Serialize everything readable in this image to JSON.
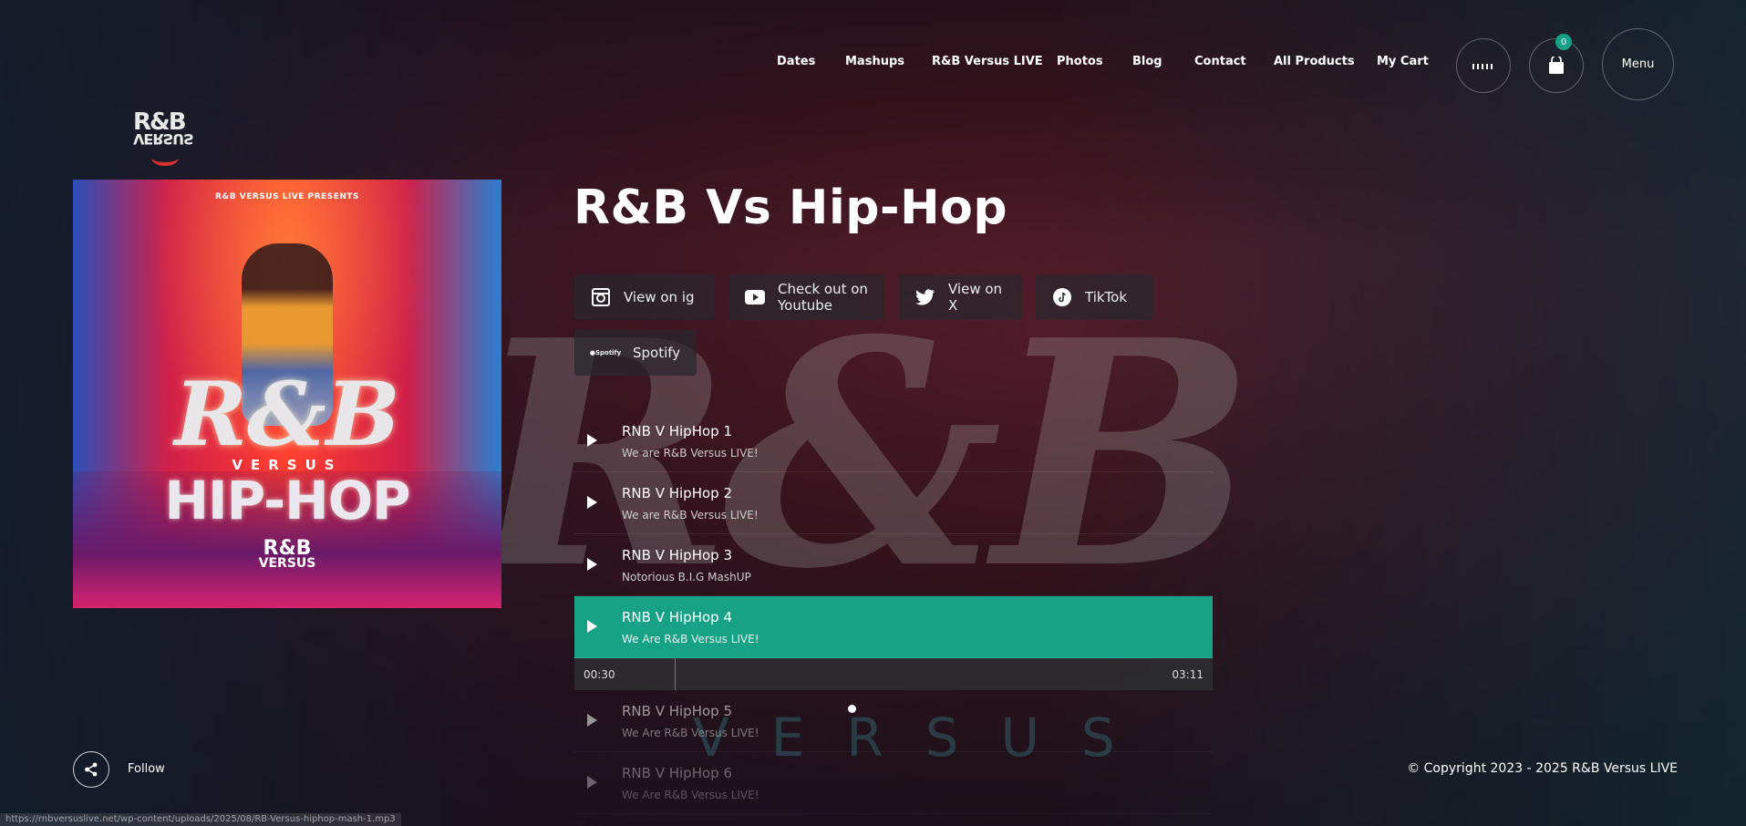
{
  "nav": {
    "links": [
      "Dates",
      "Mashups",
      "R&B Versus LIVE",
      "Photos",
      "Blog",
      "Contact",
      "All Products",
      "My Cart"
    ],
    "cart_count": "0",
    "menu_label": "Menu"
  },
  "album": {
    "presents": "R&B VERSUS LIVE PRESENTS",
    "rb": "R&B",
    "versus": "VERSUS",
    "hiphop": "HIP-HOP",
    "mini_top": "R&B",
    "mini_bottom": "VERSUS"
  },
  "page": {
    "title": "R&B Vs Hip-Hop"
  },
  "socials": [
    {
      "label_1": "View on ig",
      "label_2": "",
      "icon": "instagram-icon"
    },
    {
      "label_1": "Check out on",
      "label_2": "Youtube",
      "icon": "youtube-icon"
    },
    {
      "label_1": "View on",
      "label_2": "X",
      "icon": "twitter-icon"
    },
    {
      "label_1": "TikTok",
      "label_2": "",
      "icon": "tiktok-icon"
    },
    {
      "label_1": "Spotify",
      "label_2": "",
      "icon": "spotify-icon"
    }
  ],
  "spotify_icon_text": "Spotify",
  "tracks": [
    {
      "title": "RNB V HipHop 1",
      "subtitle": "We are R&B Versus LIVE!"
    },
    {
      "title": "RNB V HipHop 2",
      "subtitle": "We are R&B Versus LIVE!"
    },
    {
      "title": "RNB V HipHop 3",
      "subtitle": "Notorious B.I.G MashUP"
    },
    {
      "title": "RNB V HipHop 4",
      "subtitle": "We Are R&B Versus LIVE!"
    },
    {
      "title": "RNB V HipHop 5",
      "subtitle": "We Are R&B Versus LIVE!"
    },
    {
      "title": "RNB V HipHop 6",
      "subtitle": "We Are R&B Versus LIVE!"
    }
  ],
  "player": {
    "current": "00:30",
    "total": "03:11",
    "progress": 0.157
  },
  "footer": {
    "follow": "Follow",
    "copyright": "© Copyright 2023 - 2025 R&B Versus LIVE"
  },
  "status_url": "https://rnbversuslive.net/wp-content/uploads/2025/08/RB-Versus-hiphop-mash-1.mp3",
  "colors": {
    "accent": "#17a287",
    "badge": "#16a085"
  }
}
